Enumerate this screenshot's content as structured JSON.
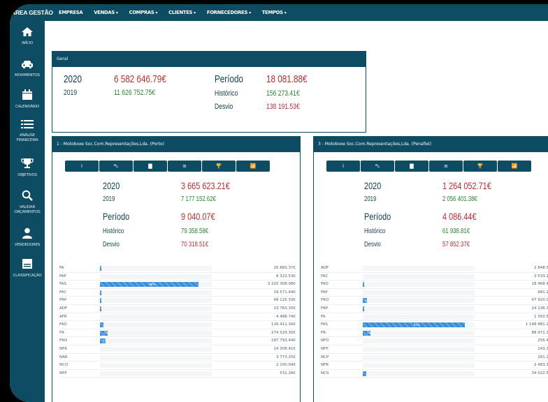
{
  "nav": {
    "brand": "ÁREA GESTÃO",
    "items": [
      {
        "label": "EMPRESA",
        "caret": false
      },
      {
        "label": "VENDAS",
        "caret": true
      },
      {
        "label": "COMPRAS",
        "caret": true
      },
      {
        "label": "CLIENTES",
        "caret": true
      },
      {
        "label": "FORNECEDORES",
        "caret": true
      },
      {
        "label": "TEMPOS",
        "caret": true
      }
    ]
  },
  "sidebar": [
    {
      "label": "INÍCIO",
      "icon": "home-icon"
    },
    {
      "label": "MOVIMENTOS",
      "icon": "car-icon"
    },
    {
      "label": "CALENDÁRIO",
      "icon": "calendar-icon"
    },
    {
      "label": "ANÁLISE\nFINANCEIRA",
      "icon": "list-icon"
    },
    {
      "label": "OBJETIVOS",
      "icon": "trophy-icon"
    },
    {
      "label": "VALIDAR\nORÇAMENTOS",
      "icon": "search-icon"
    },
    {
      "label": "VENDEDORES",
      "icon": "user-icon"
    },
    {
      "label": "CLASSIFICAÇÃO",
      "icon": "classification-icon"
    }
  ],
  "geral": {
    "title": "Geral",
    "year_current": "2020",
    "value_current": "6 582 646.79€",
    "year_prev": "2019",
    "value_prev": "11 626 752.75€",
    "periodo_label": "Período",
    "periodo_value": "18 081.88€",
    "historico_label": "Histórico",
    "historico_value": "156 273.41€",
    "desvio_label": "Desvio",
    "desvio_value": "138 191.53€"
  },
  "colors": {
    "primary": "#0e4c64",
    "green": "#2e7d2e",
    "red": "#b03030",
    "bar": "#3a8ad6"
  },
  "button_icons": [
    "info-icon",
    "car-icon",
    "calendar-icon",
    "list-icon",
    "trophy-icon",
    "chart-icon"
  ],
  "button_glyphs": [
    "i",
    "⛍",
    "▇",
    "≡",
    "🏆",
    "📶"
  ],
  "stores": [
    {
      "title": "1 - Motoboxe Soc.Com.Representações,Lda. (Porto)",
      "year_current": "2020",
      "value_current": "3 665 623.21€",
      "year_prev": "2019",
      "value_prev": "7 177 152.62€",
      "periodo_label": "Período",
      "periodo_value": "9 040.07€",
      "historico_label": "Histórico",
      "historico_value": "79 358.58€",
      "desvio_label": "Desvio",
      "desvio_value": "70 318.51€",
      "rows": [
        {
          "code": "FA",
          "pct": 1,
          "label": "",
          "value": "20 883.37€"
        },
        {
          "code": "FAP",
          "pct": 0,
          "label": "",
          "value": "8 322.53€"
        },
        {
          "code": "FAS",
          "pct": 88,
          "label": "88%",
          "value": "3 220 308.08€"
        },
        {
          "code": "FAC",
          "pct": 1,
          "label": "",
          "value": "19 571.44€"
        },
        {
          "code": "FRP",
          "pct": 1,
          "label": "",
          "value": "48 125.33€"
        },
        {
          "code": "ADF",
          "pct": 1,
          "label": "",
          "value": "23 763.35€"
        },
        {
          "code": "AFR",
          "pct": 0,
          "label": "",
          "value": "4 488.74€"
        },
        {
          "code": "FAO",
          "pct": 3,
          "label": "",
          "value": "126 411.16€"
        },
        {
          "code": "FR",
          "pct": 7,
          "label": "7%",
          "value": "274 529.30€"
        },
        {
          "code": "FRO",
          "pct": 5,
          "label": "5%",
          "value": "187 793.44€"
        },
        {
          "code": "NFR",
          "pct": 0,
          "label": "",
          "value": "14 308.41€"
        },
        {
          "code": "NAR",
          "pct": 0,
          "label": "",
          "value": "3 773.25€"
        },
        {
          "code": "NCO",
          "pct": 0,
          "label": "",
          "value": "2 100.04€"
        },
        {
          "code": "NFP",
          "pct": 0,
          "label": "",
          "value": "531.28€"
        }
      ]
    },
    {
      "title": "3 - Motoboxe Soc.Com.Representações,Lda. (Penafiel)",
      "year_current": "2020",
      "value_current": "1 264 052.71€",
      "year_prev": "2019",
      "value_prev": "2 056 401.38€",
      "periodo_label": "Período",
      "periodo_value": "4 086.44€",
      "historico_label": "Histórico",
      "historico_value": "61 938.81€",
      "desvio_label": "Desvio",
      "desvio_value": "57 852.37€",
      "rows": [
        {
          "code": "ADF",
          "pct": 0,
          "label": "",
          "value": "2 848.5"
        },
        {
          "code": "FAC",
          "pct": 0,
          "label": "",
          "value": "2 533.1"
        },
        {
          "code": "FAO",
          "pct": 1,
          "label": "",
          "value": "18 468.4"
        },
        {
          "code": "FAP",
          "pct": 0,
          "label": "",
          "value": "681.2"
        },
        {
          "code": "FRO",
          "pct": 4,
          "label": "4%",
          "value": "47 920.0"
        },
        {
          "code": "FRP",
          "pct": 1,
          "label": "",
          "value": "14 136.7"
        },
        {
          "code": "FA",
          "pct": 0,
          "label": "",
          "value": "1 350.5"
        },
        {
          "code": "FAS",
          "pct": 91,
          "label": "91%",
          "value": "1 148 881.2"
        },
        {
          "code": "FR",
          "pct": 7,
          "label": "7%",
          "value": "88 971.3"
        },
        {
          "code": "NFO",
          "pct": 0,
          "label": "",
          "value": "256.4"
        },
        {
          "code": "NFP",
          "pct": 0,
          "label": "",
          "value": "143.3"
        },
        {
          "code": "NCP",
          "pct": 0,
          "label": "",
          "value": "281.2"
        },
        {
          "code": "NFR",
          "pct": 0,
          "label": "",
          "value": "2 483.1"
        },
        {
          "code": "NCS",
          "pct": 3,
          "label": "",
          "value": "34 022.5"
        }
      ]
    }
  ]
}
